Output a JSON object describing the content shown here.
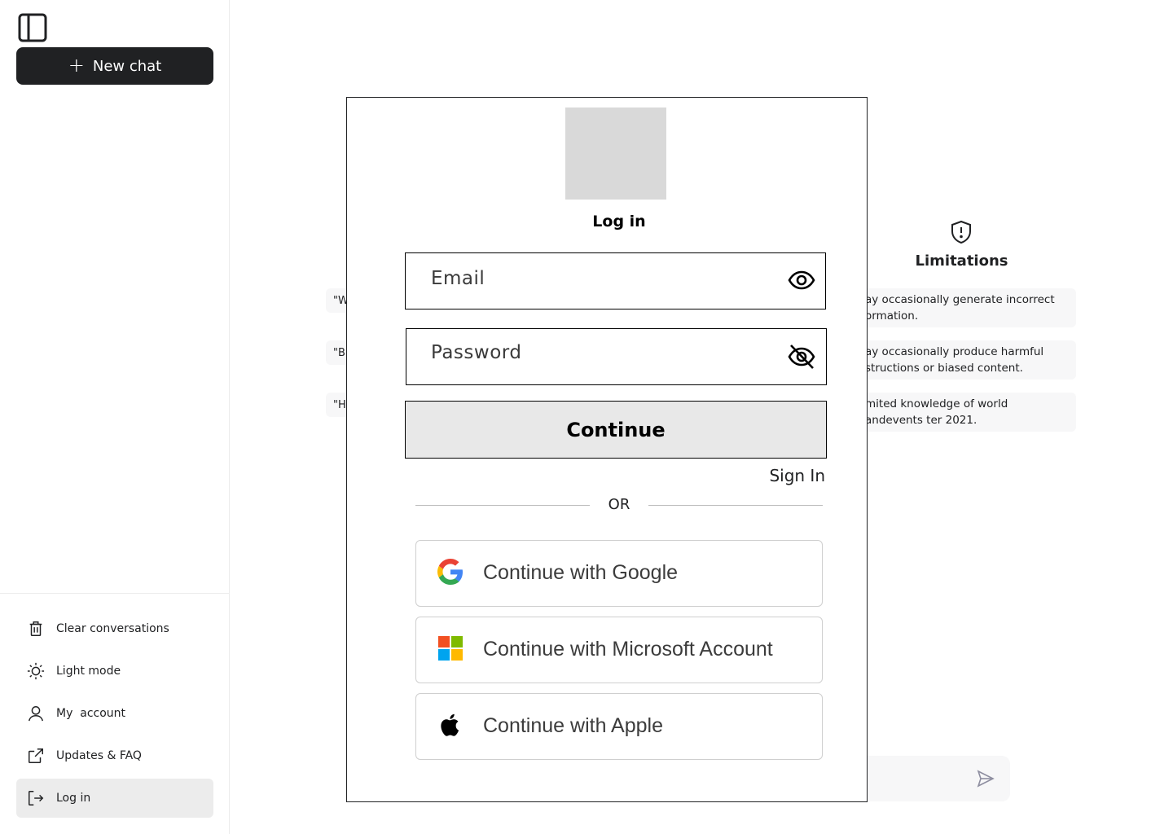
{
  "sidebar": {
    "new_chat_label": "New chat",
    "menu": [
      {
        "label": "Clear conversations",
        "icon": "trash-icon"
      },
      {
        "label": "Light mode",
        "icon": "sun-icon"
      },
      {
        "label": "My  account",
        "icon": "user-icon"
      },
      {
        "label": "Updates & FAQ",
        "icon": "external-link-icon"
      },
      {
        "label": "Log in",
        "icon": "login-icon",
        "active": true
      }
    ]
  },
  "background": {
    "examples": [
      "\"W",
      "\"B",
      "\"H"
    ],
    "limitations": {
      "title": "Limitations",
      "icon": "shield-alert-icon",
      "items": [
        "ay occasionally generate incorrect ormation.",
        "ay occasionally produce harmful structions or biased content.",
        "mited knowledge of world andevents ter 2021."
      ]
    }
  },
  "login": {
    "title": "Log in",
    "email_label": "Email",
    "password_label": "Password",
    "continue_label": "Continue",
    "signin_label": "Sign In",
    "or_label": "OR",
    "social": [
      {
        "label": "Continue with Google",
        "icon": "google-icon"
      },
      {
        "label": "Continue with Microsoft Account",
        "icon": "microsoft-icon"
      },
      {
        "label": "Continue with Apple",
        "icon": "apple-icon"
      }
    ]
  },
  "colors": {
    "primary_dark": "#202123",
    "active_bg": "#ececec",
    "card_bg": "#f7f7f8",
    "continue_bg": "#e8e8e8"
  }
}
